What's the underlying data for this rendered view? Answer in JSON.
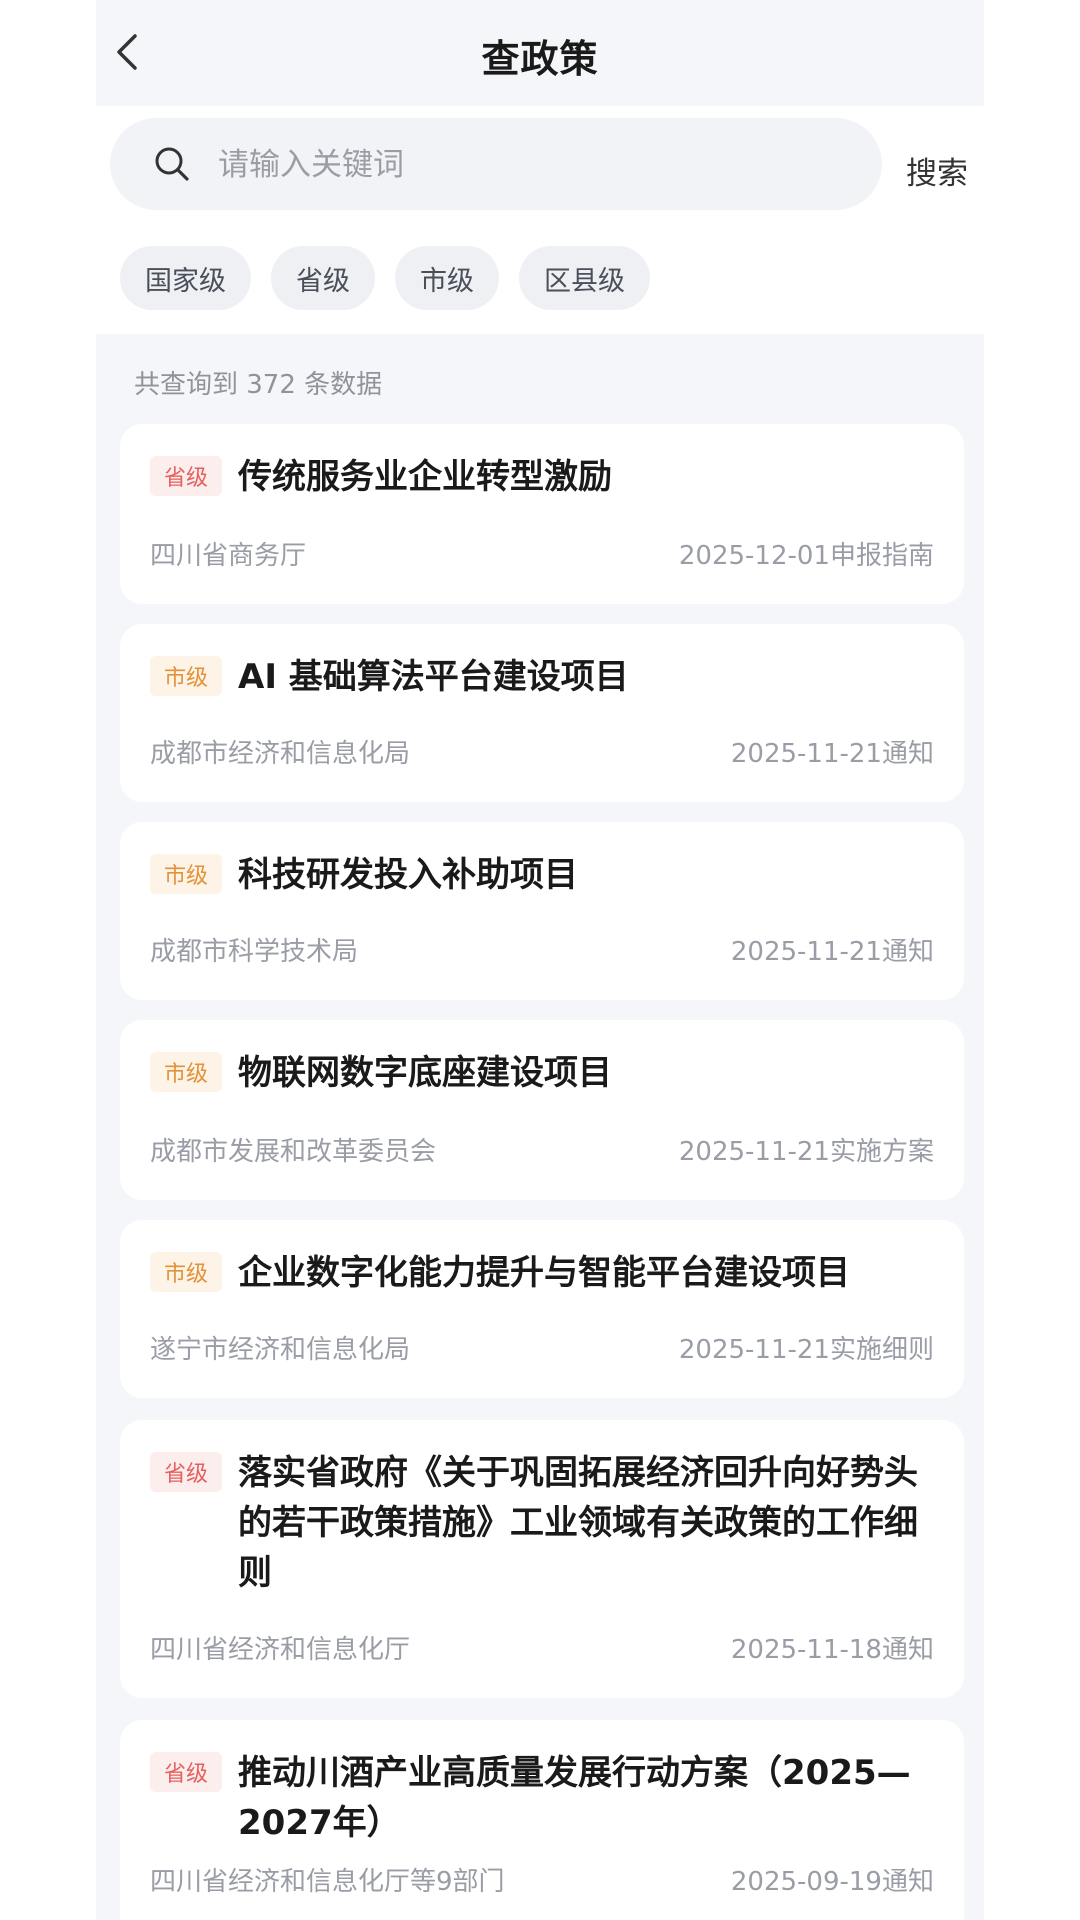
{
  "header": {
    "title": "查政策"
  },
  "search": {
    "placeholder": "请输入关键词",
    "button_label": "搜索"
  },
  "filters": [
    "国家级",
    "省级",
    "市级",
    "区县级"
  ],
  "result_count_text": "共查询到 372 条数据",
  "colors": {
    "province_tag": "#e4605e",
    "city_tag": "#e3923a"
  },
  "policies": [
    {
      "level": "省级",
      "title": "传统服务业企业转型激励",
      "org": "四川省商务厅",
      "date": "2025-12-01",
      "type": "申报指南"
    },
    {
      "level": "市级",
      "title": "AI 基础算法平台建设项目",
      "org": "成都市经济和信息化局",
      "date": "2025-11-21",
      "type": "通知"
    },
    {
      "level": "市级",
      "title": "科技研发投入补助项目",
      "org": "成都市科学技术局",
      "date": "2025-11-21",
      "type": "通知"
    },
    {
      "level": "市级",
      "title": "物联网数字底座建设项目",
      "org": "成都市发展和改革委员会",
      "date": "2025-11-21",
      "type": "实施方案"
    },
    {
      "level": "市级",
      "title": "企业数字化能力提升与智能平台建设项目",
      "org": "遂宁市经济和信息化局",
      "date": "2025-11-21",
      "type": "实施细则"
    },
    {
      "level": "省级",
      "title": "落实省政府《关于巩固拓展经济回升向好势头的若干政策措施》工业领域有关政策的工作细则",
      "org": "四川省经济和信息化厅",
      "date": "2025-11-18",
      "type": "通知"
    },
    {
      "level": "省级",
      "title": "推动川酒产业高质量发展行动方案（2025—2027年）",
      "org": "四川省经济和信息化厅等9部门",
      "date": "2025-09-19",
      "type": "通知"
    }
  ]
}
